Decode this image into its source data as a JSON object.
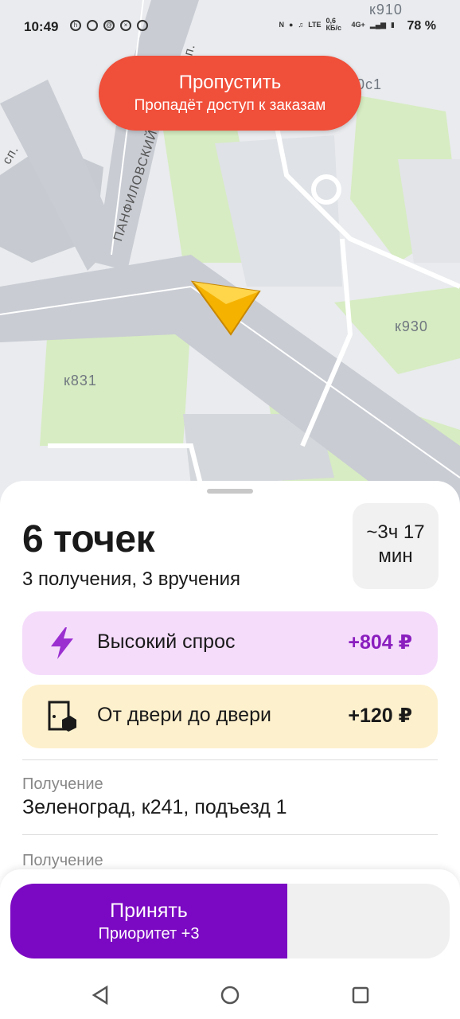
{
  "status_bar": {
    "time": "10:49",
    "battery": "78 %",
    "net_speed": "0,6 КБ/с",
    "net_type": "4G+"
  },
  "map": {
    "labels": [
      "к910",
      "0с1",
      "к930",
      "к831",
      "ПАНФИЛОВСКИЙ",
      "сп.",
      "сп."
    ]
  },
  "skip_button": {
    "title": "Пропустить",
    "subtitle": "Пропадёт доступ к заказам"
  },
  "order": {
    "title": "6 точек",
    "subtitle": "3 получения, 3 вручения",
    "eta_line1": "~3ч 17",
    "eta_line2": "мин"
  },
  "bonuses": [
    {
      "label": "Высокий спрос",
      "value": "+804 ₽",
      "icon": "lightning-icon",
      "color": "#8a1ebe"
    },
    {
      "label": "От двери до двери",
      "value": "+120 ₽",
      "icon": "door-box-icon",
      "color": "#1a1a1a"
    }
  ],
  "points": [
    {
      "type": "Получение",
      "address": "Зеленоград, к241, подъезд 1"
    },
    {
      "type": "Получение",
      "address": ""
    }
  ],
  "accept_button": {
    "title": "Принять",
    "subtitle": "Приоритет +3",
    "progress": 0.63
  },
  "colors": {
    "skip": "#f04f3a",
    "accept": "#7b08c2",
    "map_road": "#c9ccd3",
    "map_green": "#d7ecc2"
  },
  "nav": [
    "back-icon",
    "home-icon",
    "recents-icon"
  ]
}
